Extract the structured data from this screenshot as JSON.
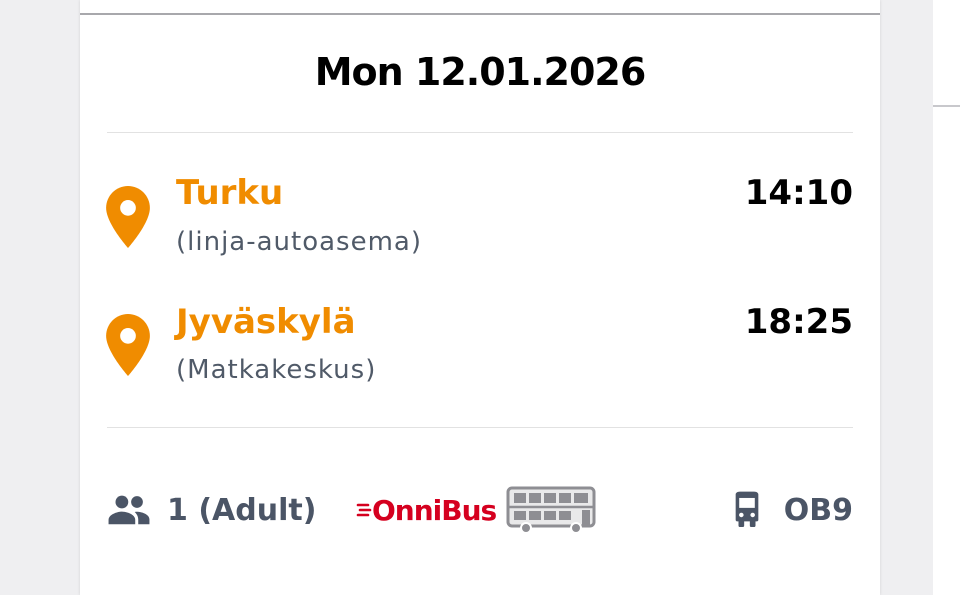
{
  "trip": {
    "date": "Mon 12.01.2026",
    "departure": {
      "city": "Turku",
      "station": "(linja-autoasema)",
      "time": "14:10"
    },
    "arrival": {
      "city": "Jyväskylä",
      "station": "(Matkakeskus)",
      "time": "18:25"
    }
  },
  "footer": {
    "passengers": "1 (Adult)",
    "operator": "OnniBus",
    "route": "OB9"
  },
  "colors": {
    "accent": "#f08c00",
    "operator_red": "#d5001f",
    "muted": "#4b5566"
  },
  "icons": {
    "pin": "location-pin-icon",
    "passengers": "people-icon",
    "bus": "bus-icon",
    "double_decker": "double-decker-bus-icon"
  }
}
